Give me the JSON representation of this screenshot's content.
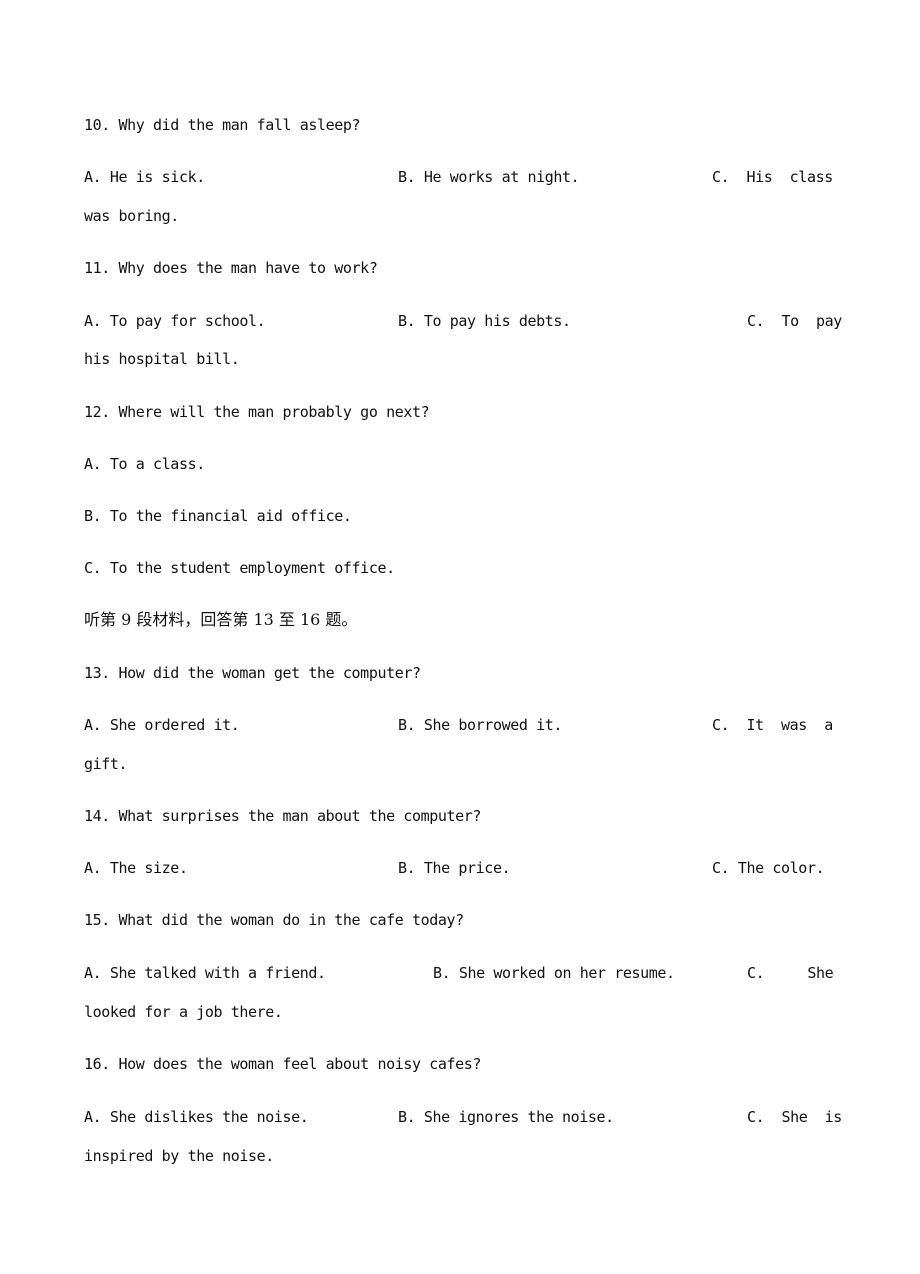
{
  "document": {
    "q10": {
      "question": "10. Why did the man fall asleep?",
      "a": "A. He is sick.",
      "b": "B. He works at night.",
      "c_line1": "C.  His  class",
      "c_line2": "was boring."
    },
    "q11": {
      "question": "11. Why does the man have to work?",
      "a": "A. To pay for school.",
      "b": "B. To pay his debts.",
      "c_line1": "C.  To  pay",
      "c_line2": "his hospital bill."
    },
    "q12": {
      "question": "12. Where will the man probably go next?",
      "a": "A. To a class.",
      "b": "B. To the financial aid office.",
      "c": "C. To the student employment office."
    },
    "section_instruction": "听第 9 段材料，回答第 13 至 16 题。",
    "q13": {
      "question": "13. How did the woman get the computer?",
      "a": "A. She ordered it.",
      "b": "B. She borrowed it.",
      "c_line1": "C.  It  was  a",
      "c_line2": "gift."
    },
    "q14": {
      "question": "14. What surprises the man about the computer?",
      "a": "A. The size.",
      "b": "B. The price.",
      "c": "C. The color."
    },
    "q15": {
      "question": "15. What did the woman do in the cafe today?",
      "a": "A. She talked with a friend.",
      "b": "B. She worked on her resume.",
      "c_line1": "C.     She",
      "c_line2": "looked for a job there."
    },
    "q16": {
      "question": "16. How does the woman feel about noisy cafes?",
      "a": "A. She dislikes the noise.",
      "b": "B. She ignores the noise.",
      "c_line1": "C.  She  is",
      "c_line2": "inspired by the noise."
    }
  }
}
